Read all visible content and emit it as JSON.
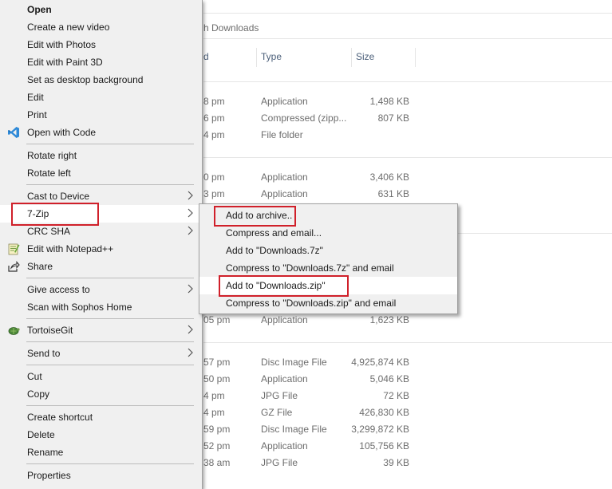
{
  "explorer": {
    "search_placeholder": "h Downloads",
    "columns": {
      "date": "d",
      "type": "Type",
      "size": "Size"
    },
    "rows": [
      {
        "date": "8 pm",
        "type": "Application",
        "size": "1,498 KB"
      },
      {
        "date": "6 pm",
        "type": "Compressed (zipp...",
        "size": "807 KB"
      },
      {
        "date": "4 pm",
        "type": "File folder",
        "size": ""
      },
      {
        "date": "0 pm",
        "type": "Application",
        "size": "3,406 KB"
      },
      {
        "date": "3 pm",
        "type": "Application",
        "size": "631 KB"
      },
      {
        "date": "05 pm",
        "type": "Application",
        "size": "1,623 KB"
      },
      {
        "date": "57 pm",
        "type": "Disc Image File",
        "size": "4,925,874 KB"
      },
      {
        "date": "50 pm",
        "type": "Application",
        "size": "5,046 KB"
      },
      {
        "date": "4 pm",
        "type": "JPG File",
        "size": "72 KB"
      },
      {
        "date": "4 pm",
        "type": "GZ File",
        "size": "426,830 KB"
      },
      {
        "date": "59 pm",
        "type": "Disc Image File",
        "size": "3,299,872 KB"
      },
      {
        "date": "52 pm",
        "type": "Application",
        "size": "105,756 KB"
      },
      {
        "date": "38 am",
        "type": "JPG File",
        "size": "39 KB"
      }
    ]
  },
  "context_menu": {
    "items": [
      {
        "label": "Open"
      },
      {
        "label": "Create a new video"
      },
      {
        "label": "Edit with Photos"
      },
      {
        "label": "Edit with Paint 3D"
      },
      {
        "label": "Set as desktop background"
      },
      {
        "label": "Edit"
      },
      {
        "label": "Print"
      },
      {
        "label": "Open with Code",
        "icon": "vscode-icon"
      },
      {
        "label": "Rotate right"
      },
      {
        "label": "Rotate left"
      },
      {
        "label": "Cast to Device"
      },
      {
        "label": "7-Zip"
      },
      {
        "label": "CRC SHA"
      },
      {
        "label": "Edit with Notepad++",
        "icon": "notepadpp-icon"
      },
      {
        "label": "Share",
        "icon": "share-icon"
      },
      {
        "label": "Give access to"
      },
      {
        "label": "Scan with Sophos Home"
      },
      {
        "label": "TortoiseGit",
        "icon": "tortoisegit-icon"
      },
      {
        "label": "Send to"
      },
      {
        "label": "Cut"
      },
      {
        "label": "Copy"
      },
      {
        "label": "Create shortcut"
      },
      {
        "label": "Delete"
      },
      {
        "label": "Rename"
      },
      {
        "label": "Properties"
      }
    ]
  },
  "submenu": {
    "items": [
      {
        "label": "Add to archive.."
      },
      {
        "label": "Compress and email..."
      },
      {
        "label": "Add to \"Downloads.7z\""
      },
      {
        "label": "Compress to \"Downloads.7z\" and email"
      },
      {
        "label": "Add to \"Downloads.zip\""
      },
      {
        "label": "Compress to \"Downloads.zip\" and email"
      }
    ]
  },
  "colors": {
    "menu_bg": "#f0f0f0",
    "highlight_box": "#d0202a",
    "vscode_blue": "#2f8ad8"
  }
}
